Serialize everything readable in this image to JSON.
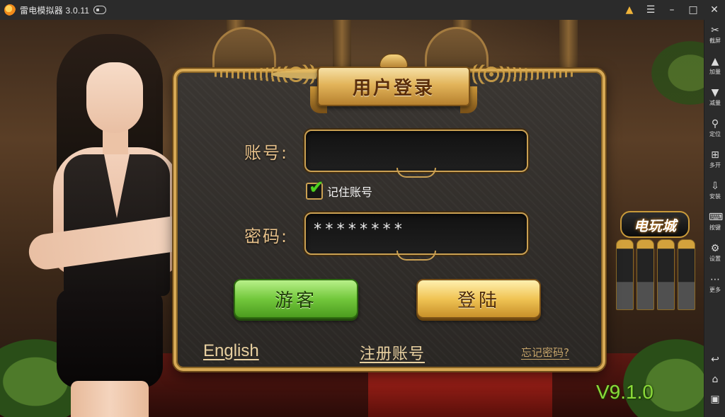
{
  "titlebar": {
    "app_title": "雷电模拟器 3.0.11",
    "gift_icon": "gift-icon",
    "menu_icon": "menu-icon",
    "minimize_icon": "minimize-icon",
    "maximize_icon": "maximize-icon",
    "close_icon": "close-icon"
  },
  "login": {
    "title": "用户登录",
    "account_label": "账号:",
    "account_value": "",
    "remember_label": "记住账号",
    "remember_checked": true,
    "password_label": "密码:",
    "password_value": "********",
    "guest_button": "游客",
    "login_button": "登陆",
    "english_link": "English",
    "register_link": "注册账号",
    "forgot_link": "忘记密码?"
  },
  "scene": {
    "slot_sign": "电玩城",
    "version": "V9.1.0"
  },
  "sidebar": {
    "items": [
      {
        "label": "截屏",
        "icon": "scissors-icon"
      },
      {
        "label": "加量",
        "icon": "volume-up-icon"
      },
      {
        "label": "减量",
        "icon": "volume-down-icon"
      },
      {
        "label": "定位",
        "icon": "location-icon"
      },
      {
        "label": "多开",
        "icon": "multi-instance-icon"
      },
      {
        "label": "安装",
        "icon": "apk-install-icon"
      },
      {
        "label": "按键",
        "icon": "keyboard-icon"
      },
      {
        "label": "设置",
        "icon": "settings-icon"
      },
      {
        "label": "更多",
        "icon": "more-icon"
      }
    ],
    "nav": [
      "back-icon",
      "home-icon",
      "recent-apps-icon"
    ]
  },
  "colors": {
    "panel_border": "#d7a955",
    "label_gold": "#e6c08a",
    "guest_green": "#73c83c",
    "login_gold": "#f0c454",
    "version_green": "#8bd93a",
    "chrome_dark": "#2b2b2b"
  }
}
